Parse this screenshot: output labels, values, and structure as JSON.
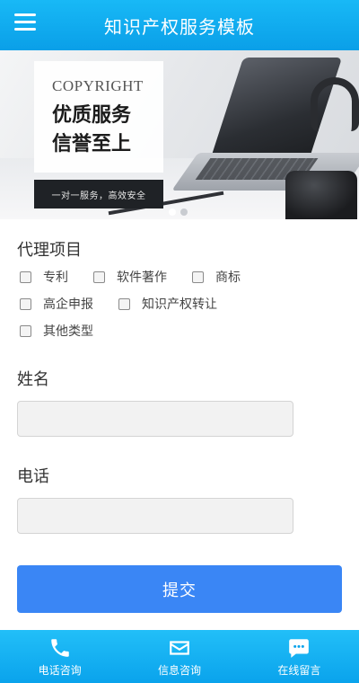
{
  "header": {
    "title": "知识产权服务模板",
    "menu_icon": "hamburger-menu-icon"
  },
  "banner": {
    "title_en": "COPYRIGHT",
    "title_cn_line1": "优质服务",
    "title_cn_line2": "信誉至上",
    "tagline": "一对一服务，高效安全",
    "slide_count": 2,
    "active_slide": 0
  },
  "form": {
    "project_label": "代理项目",
    "options": [
      "专利",
      "软件著作",
      "商标",
      "高企申报",
      "知识产权转让",
      "其他类型"
    ],
    "name_label": "姓名",
    "name_value": "",
    "phone_label": "电话",
    "phone_value": "",
    "submit_label": "提交"
  },
  "bottom_nav": {
    "items": [
      {
        "label": "电话咨询",
        "icon": "phone-icon"
      },
      {
        "label": "信息咨询",
        "icon": "mail-icon"
      },
      {
        "label": "在线留言",
        "icon": "chat-bubble-icon"
      }
    ]
  },
  "colors": {
    "header_bg": "#0aa3ec",
    "submit_bg": "#3a86f5",
    "nav_bg": "#0aa3ec"
  }
}
